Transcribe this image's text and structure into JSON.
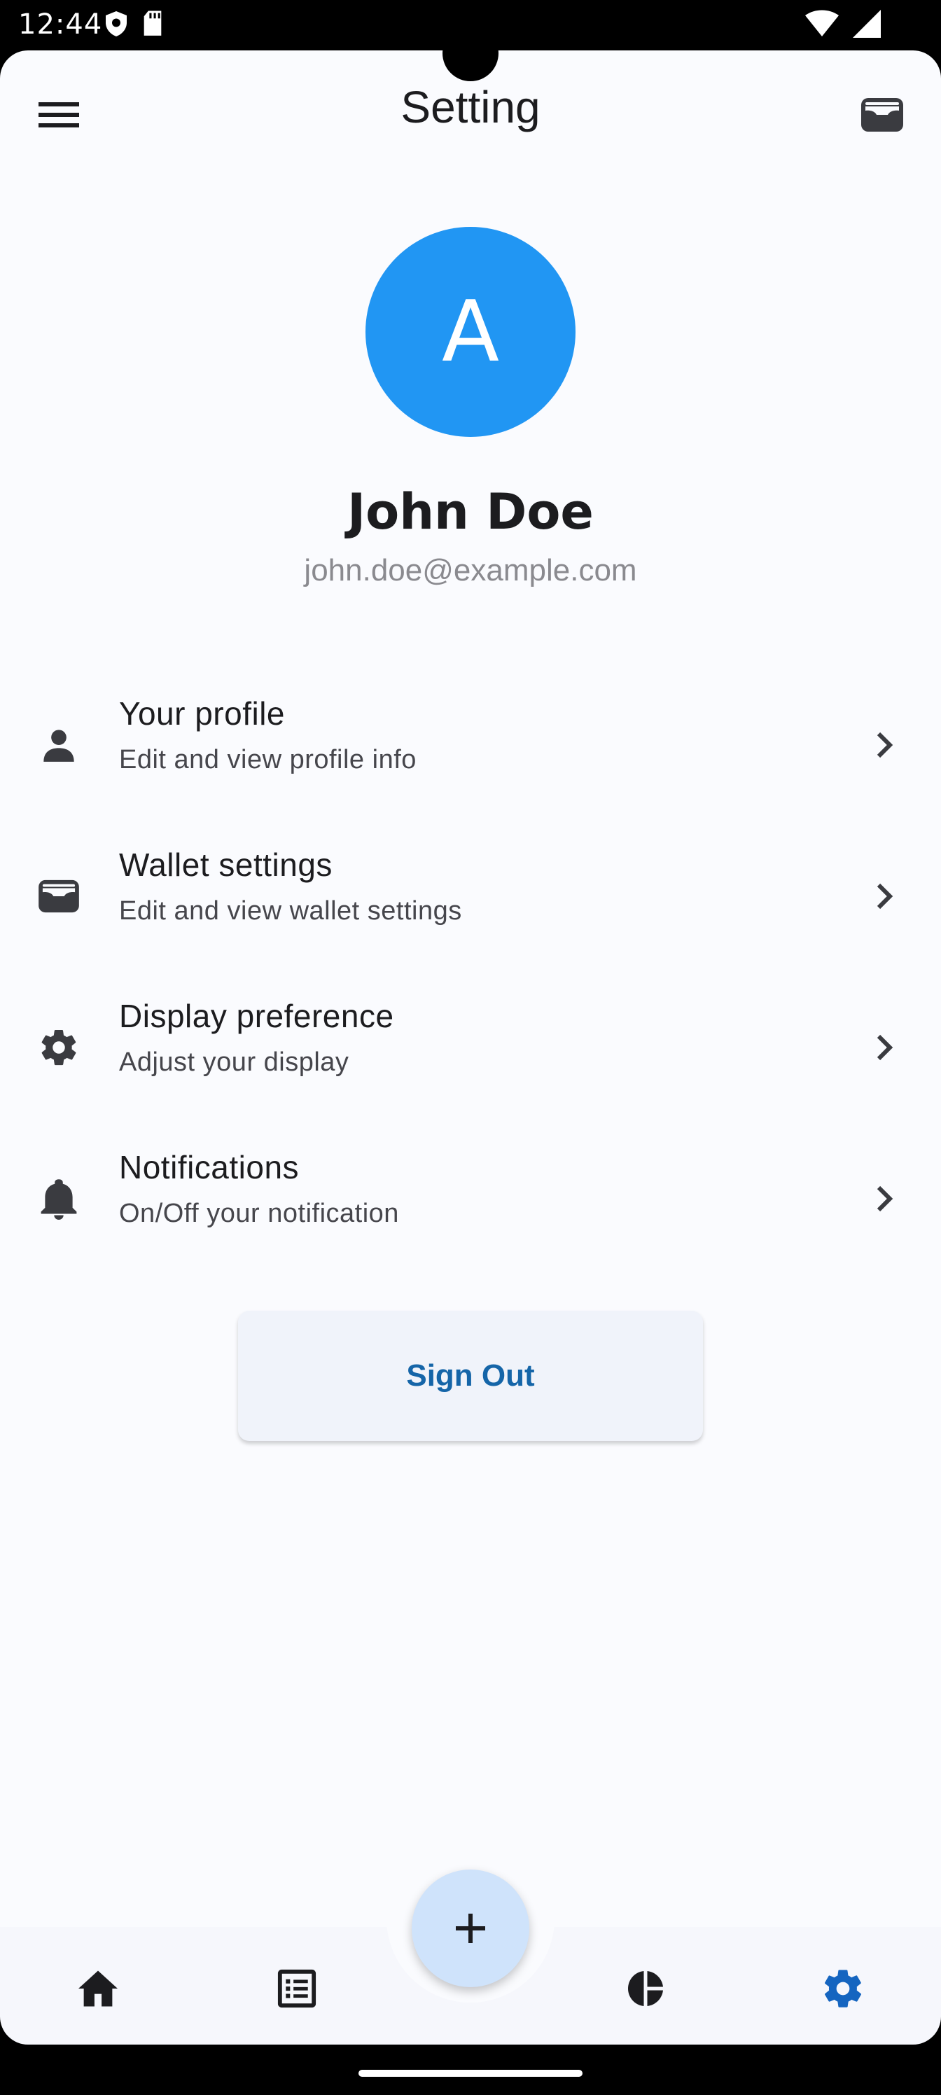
{
  "status_bar": {
    "time": "12:44"
  },
  "app_bar": {
    "title": "Setting"
  },
  "profile": {
    "initial": "A",
    "name": "John Doe",
    "email": "john.doe@example.com",
    "avatar_color": "#2196f3"
  },
  "settings": [
    {
      "title": "Your profile",
      "subtitle": "Edit and view profile info",
      "icon": "person-icon"
    },
    {
      "title": "Wallet settings",
      "subtitle": "Edit and view wallet settings",
      "icon": "wallet-icon"
    },
    {
      "title": "Display preference",
      "subtitle": "Adjust your display",
      "icon": "gear-icon"
    },
    {
      "title": "Notifications",
      "subtitle": "On/Off your notification",
      "icon": "bell-icon"
    }
  ],
  "sign_out_label": "Sign Out",
  "bottom_nav": {
    "items": [
      "home-icon",
      "list-icon",
      "pie-chart-icon",
      "settings-icon"
    ],
    "active": "settings-icon",
    "active_color": "#1565c0"
  }
}
